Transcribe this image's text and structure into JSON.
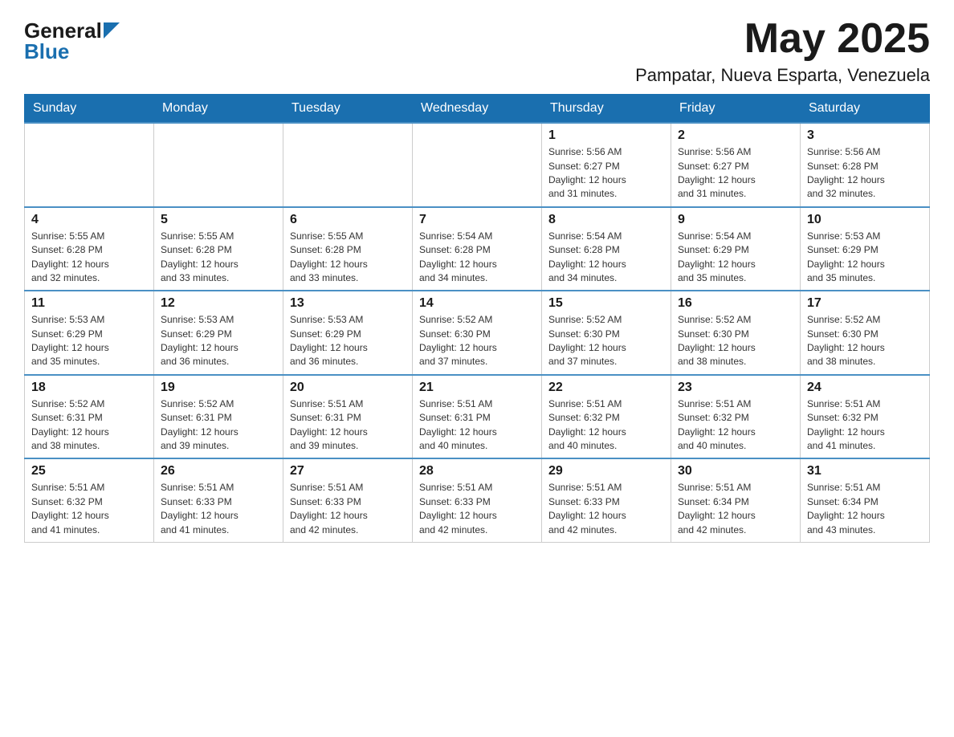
{
  "logo": {
    "general": "General",
    "blue": "Blue"
  },
  "title": "May 2025",
  "location": "Pampatar, Nueva Esparta, Venezuela",
  "days_of_week": [
    "Sunday",
    "Monday",
    "Tuesday",
    "Wednesday",
    "Thursday",
    "Friday",
    "Saturday"
  ],
  "weeks": [
    [
      {
        "day": "",
        "info": ""
      },
      {
        "day": "",
        "info": ""
      },
      {
        "day": "",
        "info": ""
      },
      {
        "day": "",
        "info": ""
      },
      {
        "day": "1",
        "info": "Sunrise: 5:56 AM\nSunset: 6:27 PM\nDaylight: 12 hours\nand 31 minutes."
      },
      {
        "day": "2",
        "info": "Sunrise: 5:56 AM\nSunset: 6:27 PM\nDaylight: 12 hours\nand 31 minutes."
      },
      {
        "day": "3",
        "info": "Sunrise: 5:56 AM\nSunset: 6:28 PM\nDaylight: 12 hours\nand 32 minutes."
      }
    ],
    [
      {
        "day": "4",
        "info": "Sunrise: 5:55 AM\nSunset: 6:28 PM\nDaylight: 12 hours\nand 32 minutes."
      },
      {
        "day": "5",
        "info": "Sunrise: 5:55 AM\nSunset: 6:28 PM\nDaylight: 12 hours\nand 33 minutes."
      },
      {
        "day": "6",
        "info": "Sunrise: 5:55 AM\nSunset: 6:28 PM\nDaylight: 12 hours\nand 33 minutes."
      },
      {
        "day": "7",
        "info": "Sunrise: 5:54 AM\nSunset: 6:28 PM\nDaylight: 12 hours\nand 34 minutes."
      },
      {
        "day": "8",
        "info": "Sunrise: 5:54 AM\nSunset: 6:28 PM\nDaylight: 12 hours\nand 34 minutes."
      },
      {
        "day": "9",
        "info": "Sunrise: 5:54 AM\nSunset: 6:29 PM\nDaylight: 12 hours\nand 35 minutes."
      },
      {
        "day": "10",
        "info": "Sunrise: 5:53 AM\nSunset: 6:29 PM\nDaylight: 12 hours\nand 35 minutes."
      }
    ],
    [
      {
        "day": "11",
        "info": "Sunrise: 5:53 AM\nSunset: 6:29 PM\nDaylight: 12 hours\nand 35 minutes."
      },
      {
        "day": "12",
        "info": "Sunrise: 5:53 AM\nSunset: 6:29 PM\nDaylight: 12 hours\nand 36 minutes."
      },
      {
        "day": "13",
        "info": "Sunrise: 5:53 AM\nSunset: 6:29 PM\nDaylight: 12 hours\nand 36 minutes."
      },
      {
        "day": "14",
        "info": "Sunrise: 5:52 AM\nSunset: 6:30 PM\nDaylight: 12 hours\nand 37 minutes."
      },
      {
        "day": "15",
        "info": "Sunrise: 5:52 AM\nSunset: 6:30 PM\nDaylight: 12 hours\nand 37 minutes."
      },
      {
        "day": "16",
        "info": "Sunrise: 5:52 AM\nSunset: 6:30 PM\nDaylight: 12 hours\nand 38 minutes."
      },
      {
        "day": "17",
        "info": "Sunrise: 5:52 AM\nSunset: 6:30 PM\nDaylight: 12 hours\nand 38 minutes."
      }
    ],
    [
      {
        "day": "18",
        "info": "Sunrise: 5:52 AM\nSunset: 6:31 PM\nDaylight: 12 hours\nand 38 minutes."
      },
      {
        "day": "19",
        "info": "Sunrise: 5:52 AM\nSunset: 6:31 PM\nDaylight: 12 hours\nand 39 minutes."
      },
      {
        "day": "20",
        "info": "Sunrise: 5:51 AM\nSunset: 6:31 PM\nDaylight: 12 hours\nand 39 minutes."
      },
      {
        "day": "21",
        "info": "Sunrise: 5:51 AM\nSunset: 6:31 PM\nDaylight: 12 hours\nand 40 minutes."
      },
      {
        "day": "22",
        "info": "Sunrise: 5:51 AM\nSunset: 6:32 PM\nDaylight: 12 hours\nand 40 minutes."
      },
      {
        "day": "23",
        "info": "Sunrise: 5:51 AM\nSunset: 6:32 PM\nDaylight: 12 hours\nand 40 minutes."
      },
      {
        "day": "24",
        "info": "Sunrise: 5:51 AM\nSunset: 6:32 PM\nDaylight: 12 hours\nand 41 minutes."
      }
    ],
    [
      {
        "day": "25",
        "info": "Sunrise: 5:51 AM\nSunset: 6:32 PM\nDaylight: 12 hours\nand 41 minutes."
      },
      {
        "day": "26",
        "info": "Sunrise: 5:51 AM\nSunset: 6:33 PM\nDaylight: 12 hours\nand 41 minutes."
      },
      {
        "day": "27",
        "info": "Sunrise: 5:51 AM\nSunset: 6:33 PM\nDaylight: 12 hours\nand 42 minutes."
      },
      {
        "day": "28",
        "info": "Sunrise: 5:51 AM\nSunset: 6:33 PM\nDaylight: 12 hours\nand 42 minutes."
      },
      {
        "day": "29",
        "info": "Sunrise: 5:51 AM\nSunset: 6:33 PM\nDaylight: 12 hours\nand 42 minutes."
      },
      {
        "day": "30",
        "info": "Sunrise: 5:51 AM\nSunset: 6:34 PM\nDaylight: 12 hours\nand 42 minutes."
      },
      {
        "day": "31",
        "info": "Sunrise: 5:51 AM\nSunset: 6:34 PM\nDaylight: 12 hours\nand 43 minutes."
      }
    ]
  ]
}
